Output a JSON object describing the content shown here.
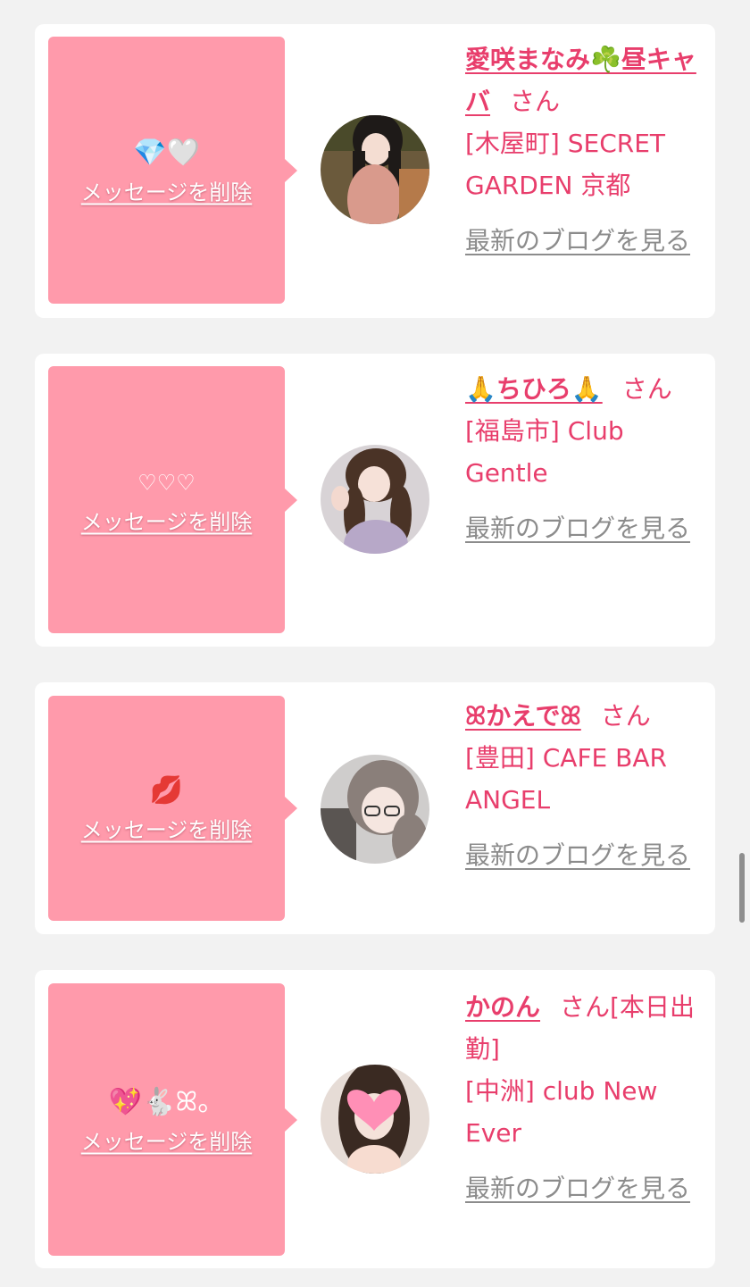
{
  "delete_label": "メッセージを削除",
  "blog_label": "最新のブログを見る",
  "san_label": "さん",
  "cards": [
    {
      "emoji": "💎🤍",
      "name": "愛咲まなみ☘️昼キャバ",
      "suffix": "",
      "venue": "[木屋町] SECRET GARDEN 京都"
    },
    {
      "emoji": "♡♡♡",
      "name": "🙏ちひろ🙏",
      "suffix": "",
      "venue": "[福島市] Club Gentle"
    },
    {
      "emoji": "💋",
      "name": "ꕤかえでꕤ",
      "suffix": "",
      "venue": "[豊田] CAFE BAR ANGEL"
    },
    {
      "emoji": "💖🐇ꕤ。",
      "name": "かのん",
      "suffix": "[本日出勤]",
      "venue": "[中洲] club New Ever"
    }
  ],
  "colors": {
    "page_bg": "#f2f2f2",
    "card_bg": "#ffffff",
    "message_box": "#ff9aab",
    "accent_text": "#e83e6c",
    "blog_link": "#8c8c8c"
  }
}
